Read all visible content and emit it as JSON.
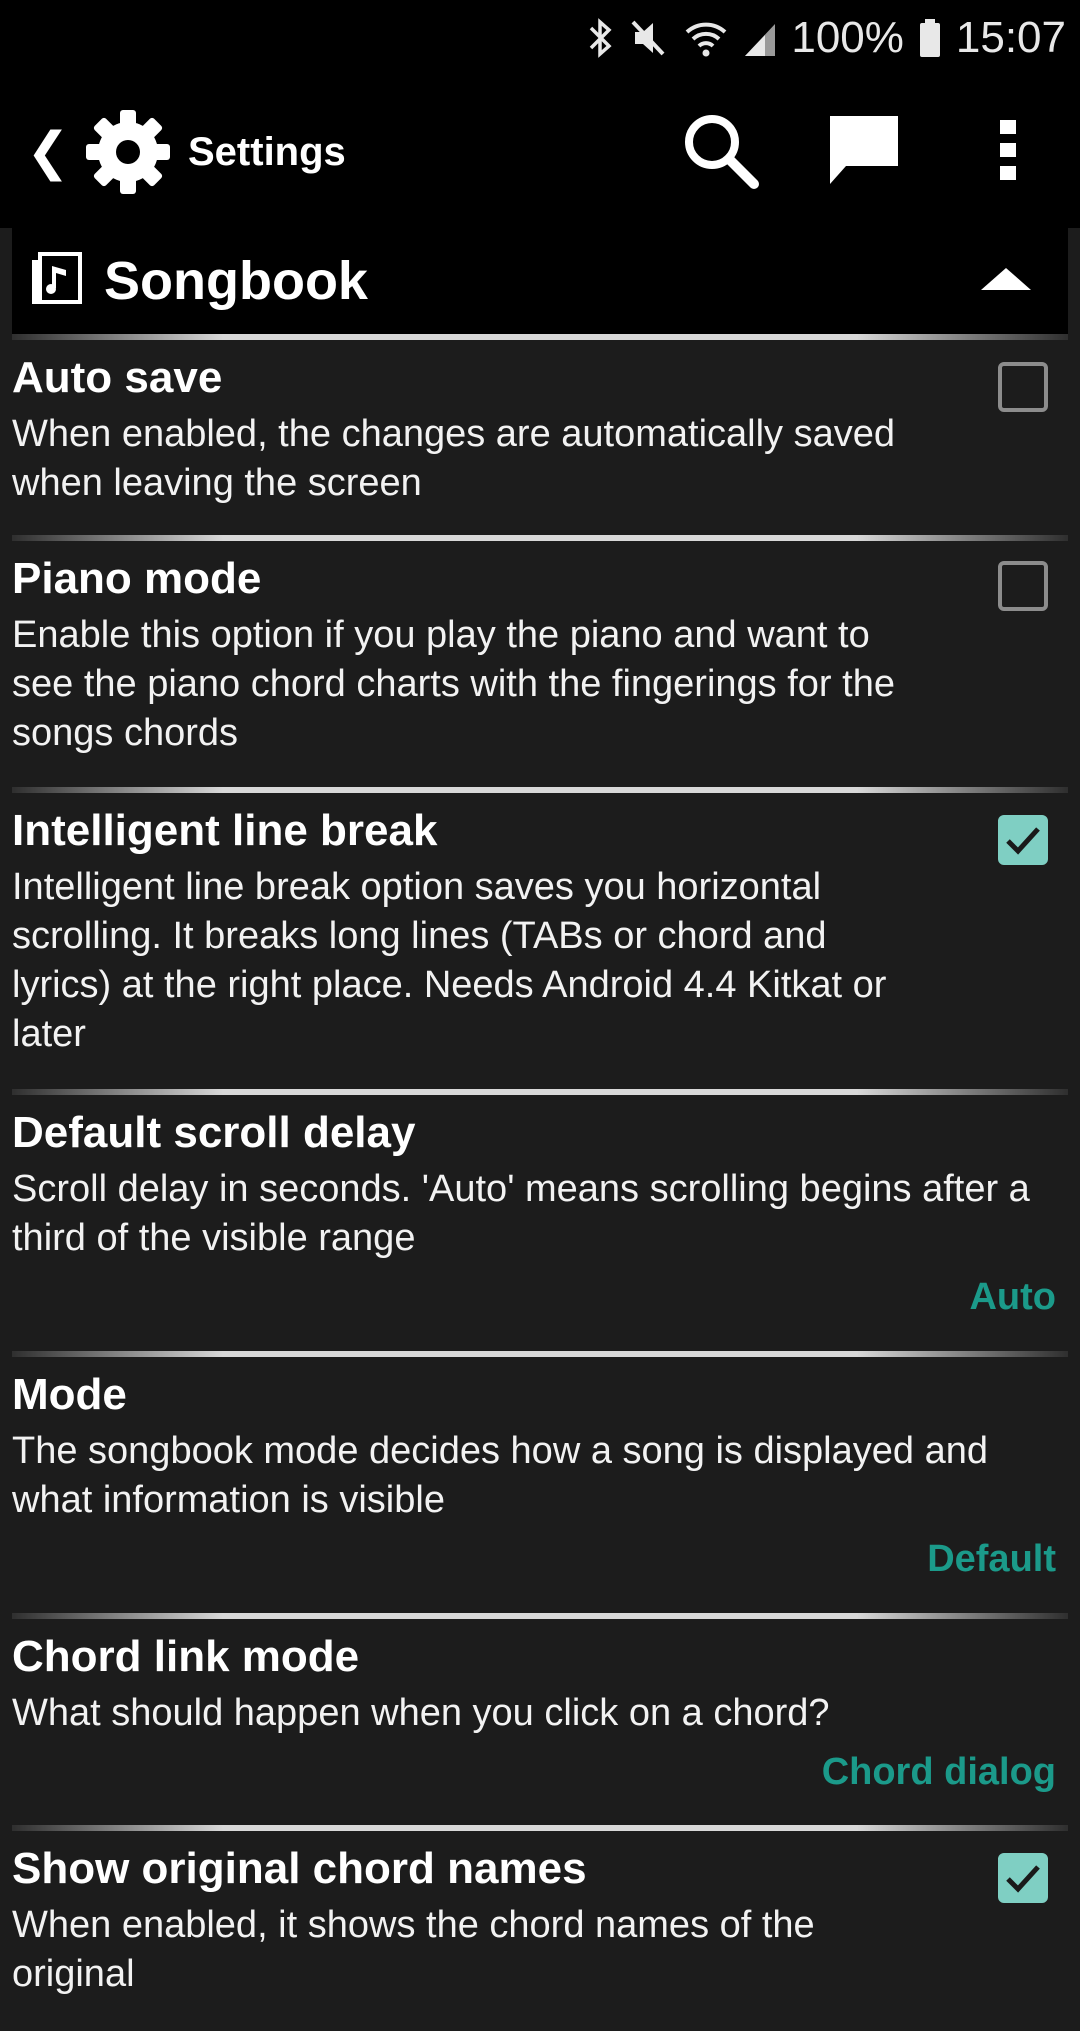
{
  "status_bar": {
    "battery": "100%",
    "time": "15:07"
  },
  "toolbar": {
    "back_glyph": "❮",
    "title": "Settings",
    "icons": [
      "gear-icon",
      "search-icon",
      "chat-icon",
      "overflow-menu-icon"
    ]
  },
  "section": {
    "title": "Songbook",
    "icon": "songbook-icon"
  },
  "preferences": [
    {
      "title": "Auto save",
      "summary": "When enabled, the changes are automatically saved when leaving the screen",
      "checked": false
    },
    {
      "title": "Piano mode",
      "summary": "Enable this option if you play the piano and want to see the piano chord charts with the fingerings for the songs chords",
      "checked": false
    },
    {
      "title": "Intelligent line break",
      "summary": "Intelligent line break option saves you horizontal scrolling. It breaks long lines (TABs or chord and lyrics) at the right place. Needs Android 4.4 Kitkat or later",
      "checked": true
    },
    {
      "title": "Default scroll delay",
      "summary": "Scroll delay in seconds. 'Auto' means scrolling begins after a third of the visible range",
      "value": "Auto"
    },
    {
      "title": "Mode",
      "summary": "The songbook mode decides how a song is displayed and what information is visible",
      "value": "Default"
    },
    {
      "title": "Chord link mode",
      "summary": "What should happen when you click on a chord?",
      "value": "Chord dialog"
    },
    {
      "title": "Show original chord names",
      "summary": "When enabled, it shows the chord names of the original",
      "checked": true
    }
  ],
  "colors": {
    "accent": "#1b9a8a",
    "checkbox_checked": "#7fcfc3",
    "background": "#1c1c1c",
    "bar": "#000000"
  }
}
